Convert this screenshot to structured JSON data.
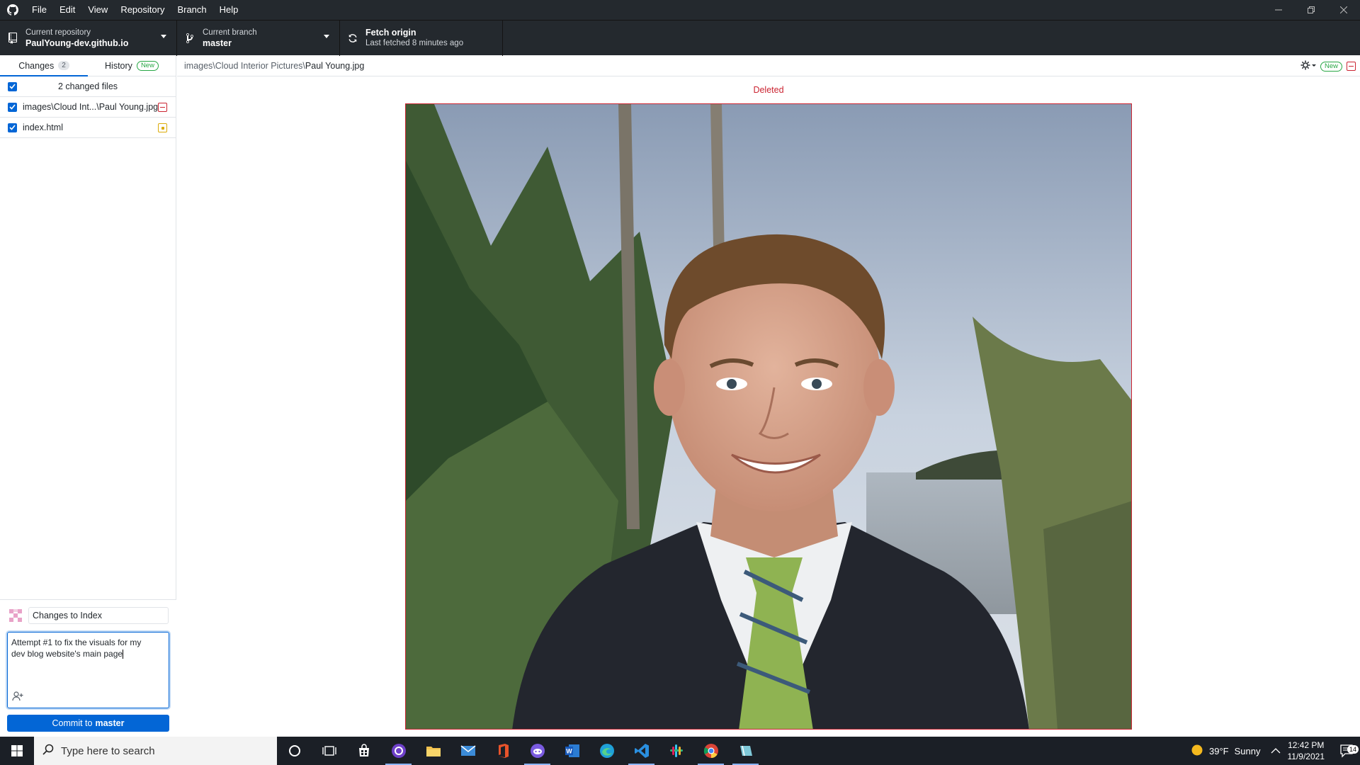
{
  "menu": [
    "File",
    "Edit",
    "View",
    "Repository",
    "Branch",
    "Help"
  ],
  "toolbar": {
    "repo_label": "Current repository",
    "repo_name": "PaulYoung-dev.github.io",
    "branch_label": "Current branch",
    "branch_name": "master",
    "fetch_title": "Fetch origin",
    "fetch_sub": "Last fetched 8 minutes ago"
  },
  "tabs": {
    "changes_label": "Changes",
    "changes_count": "2",
    "history_label": "History",
    "history_badge": "New"
  },
  "changes": {
    "header": "2 changed files",
    "files": [
      {
        "name": "images\\Cloud Int...\\Paul Young.jpg",
        "status": "deleted"
      },
      {
        "name": "index.html",
        "status": "modified"
      }
    ]
  },
  "commit": {
    "summary": "Changes to Index",
    "description": "Attempt #1 to fix the visuals for my dev blog website's main page",
    "button_prefix": "Commit to",
    "button_branch": "master"
  },
  "diff": {
    "path_dir": "images\\Cloud Interior Pictures\\",
    "path_file": "Paul Young.jpg",
    "new_badge": "New",
    "status_label": "Deleted"
  },
  "taskbar": {
    "search_placeholder": "Type here to search",
    "weather_temp": "39°F",
    "weather_desc": "Sunny",
    "time": "12:42 PM",
    "date": "11/9/2021",
    "notification_count": "14"
  },
  "colors": {
    "deleted": "#cb2431",
    "modified": "#dbab09",
    "accent": "#0366d6",
    "chrome": "#24292e"
  }
}
